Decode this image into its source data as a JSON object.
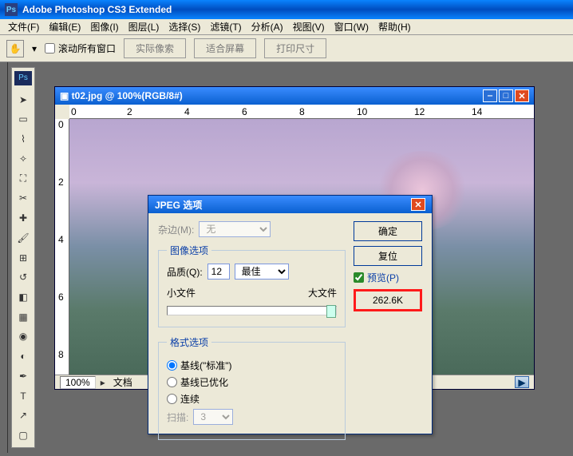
{
  "app": {
    "title": "Adobe Photoshop CS3 Extended"
  },
  "menu": {
    "file": "文件(F)",
    "edit": "编辑(E)",
    "image": "图像(I)",
    "layer": "图层(L)",
    "select": "选择(S)",
    "filter": "滤镜(T)",
    "analysis": "分析(A)",
    "view": "视图(V)",
    "window": "窗口(W)",
    "help": "帮助(H)"
  },
  "options": {
    "scroll_all": "滚动所有窗口",
    "actual_pixels": "实际像索",
    "fit_screen": "适合屏幕",
    "print_size": "打印尺寸"
  },
  "doc": {
    "title": "t02.jpg @ 100%(RGB/8#)",
    "zoom": "100%",
    "status_prefix": "文档",
    "ruler_h": [
      "0",
      "2",
      "4",
      "6",
      "8",
      "10",
      "12",
      "14"
    ],
    "ruler_v": [
      "0",
      "2",
      "4",
      "6",
      "8"
    ]
  },
  "dialog": {
    "title": "JPEG 选项",
    "matting_label": "杂边(M):",
    "matting_value": "无",
    "image_options_legend": "图像选项",
    "quality_label": "品质(Q):",
    "quality_value": "12",
    "quality_preset": "最佳",
    "small_file": "小文件",
    "large_file": "大文件",
    "format_legend": "格式选项",
    "baseline_std": "基线(\"标准\")",
    "baseline_opt": "基线已优化",
    "progressive": "连续",
    "scans_label": "扫描:",
    "scans_value": "3",
    "ok": "确定",
    "reset": "复位",
    "preview": "预览(P)",
    "filesize": "262.6K"
  }
}
